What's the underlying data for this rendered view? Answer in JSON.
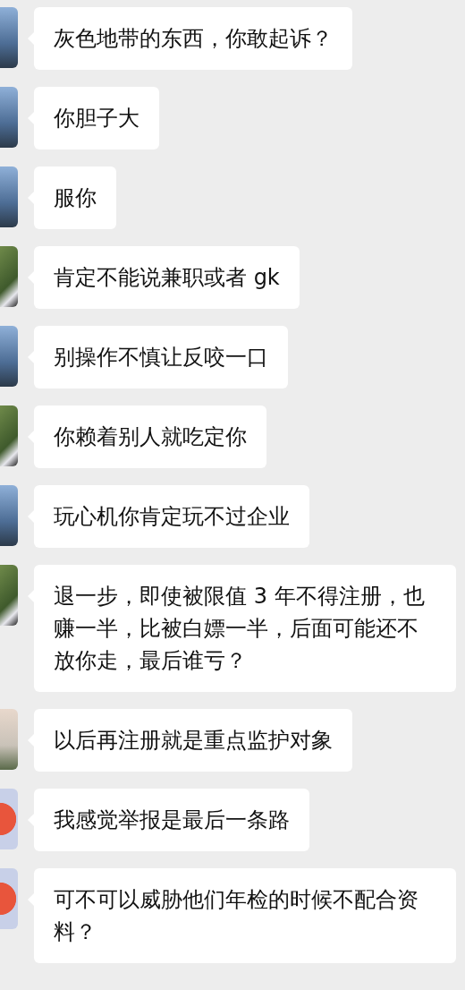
{
  "messages": [
    {
      "kind": "sea",
      "text": "灰色地带的东西，你敢起诉？"
    },
    {
      "kind": "sea",
      "text": "你胆子大"
    },
    {
      "kind": "sea",
      "text": "服你"
    },
    {
      "kind": "garden",
      "text": "肯定不能说兼职或者 gk"
    },
    {
      "kind": "sea",
      "text": "别操作不慎让反咬一口"
    },
    {
      "kind": "garden",
      "text": "你赖着别人就吃定你"
    },
    {
      "kind": "sea",
      "text": "玩心机你肯定玩不过企业"
    },
    {
      "kind": "garden",
      "text": "退一步，即使被限值 3 年不得注册，也赚一半，比被白嫖一半，后面可能还不放你走，最后谁亏？"
    },
    {
      "kind": "building",
      "text": "以后再注册就是重点监护对象"
    },
    {
      "kind": "cartoon",
      "text": "我感觉举报是最后一条路"
    },
    {
      "kind": "cartoon",
      "text": "可不可以威胁他们年检的时候不配合资料？"
    }
  ]
}
